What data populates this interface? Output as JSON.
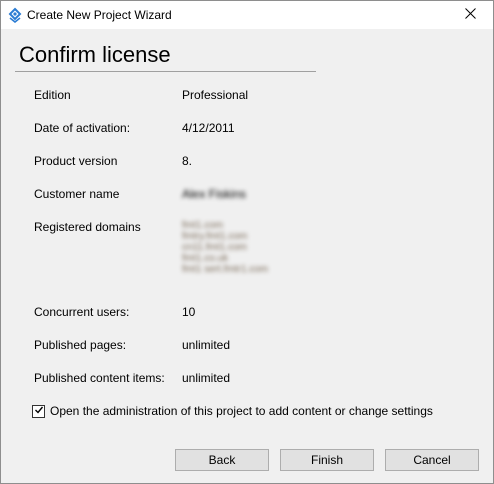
{
  "window": {
    "title": "Create New Project Wizard",
    "icon": "app-logo-icon"
  },
  "page": {
    "heading": "Confirm license"
  },
  "license": {
    "edition": {
      "label": "Edition",
      "value": "Professional"
    },
    "activation": {
      "label": "Date of activation:",
      "value": "4/12/2011"
    },
    "version": {
      "label": "Product version",
      "value": "8."
    },
    "customer": {
      "label": "Customer name",
      "value": "Alex Fiskins"
    },
    "domains": {
      "label": "Registered domains",
      "values": [
        "fmt1.com",
        "fmtry.fmt1.com",
        "cn11.fmt1.com",
        "fmt1.co.uk",
        "fmt1 sert.fmtr1.com"
      ]
    },
    "users": {
      "label": "Concurrent users:",
      "value": "10"
    },
    "pages": {
      "label": "Published pages:",
      "value": "unlimited"
    },
    "items": {
      "label": "Published content items:",
      "value": "unlimited"
    }
  },
  "option": {
    "checked": true,
    "label": "Open the administration of this project to add content or change settings"
  },
  "buttons": {
    "back": "Back",
    "finish": "Finish",
    "cancel": "Cancel"
  }
}
